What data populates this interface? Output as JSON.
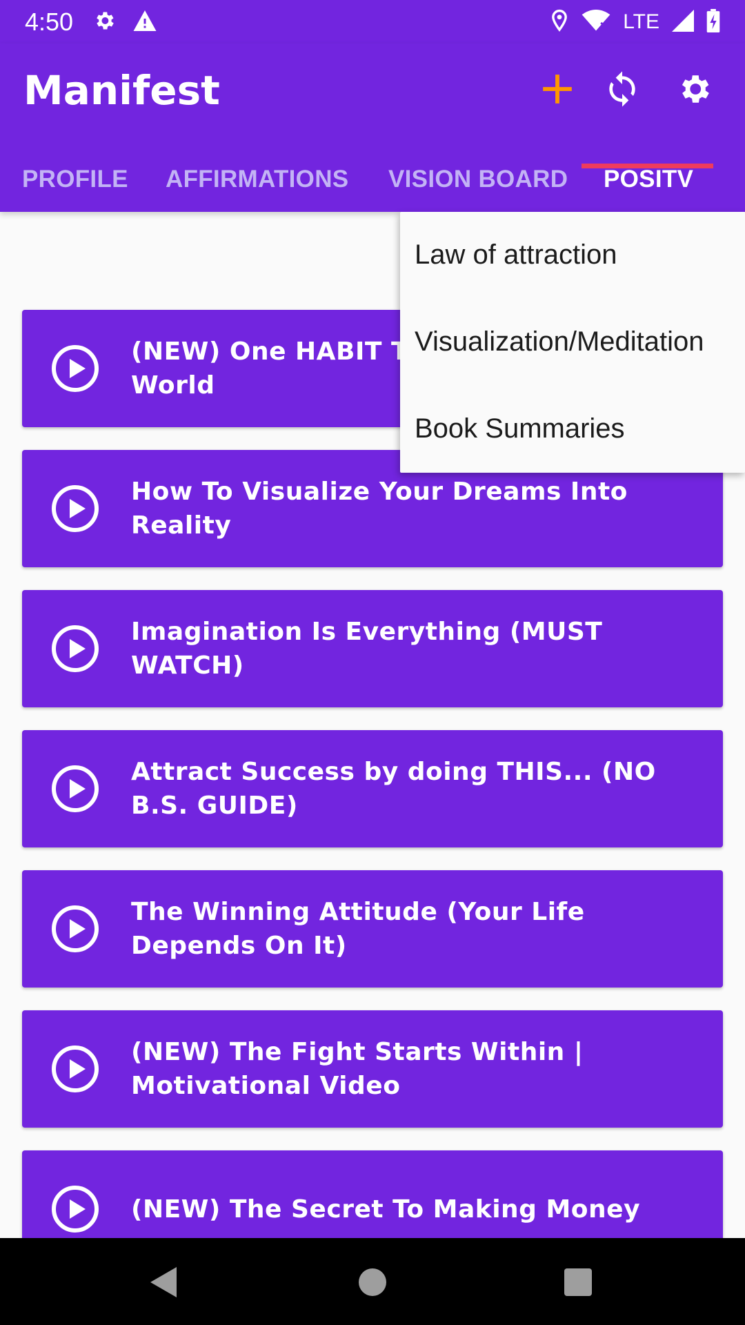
{
  "status_bar": {
    "time": "4:50",
    "network": "LTE",
    "icons": [
      "gear-icon",
      "warning-icon",
      "location-icon",
      "wifi-icon",
      "signal-icon",
      "battery-icon"
    ]
  },
  "app_bar": {
    "title": "Manifest",
    "actions": [
      "add-icon",
      "sync-icon",
      "settings-icon"
    ],
    "add_color": "#ff9800"
  },
  "tabs": [
    {
      "label": "PROFILE",
      "active": false
    },
    {
      "label": "AFFIRMATIONS",
      "active": false
    },
    {
      "label": "VISION BOARD",
      "active": false
    },
    {
      "label": "POSITV",
      "active": true
    }
  ],
  "dropdown": {
    "items": [
      "Law of attraction",
      "Visualization/Meditation",
      "Book Summaries"
    ]
  },
  "videos": [
    {
      "title": "(NEW) One HABIT Th\nWorld"
    },
    {
      "title": "How To Visualize Your Dreams Into Reality"
    },
    {
      "title": "Imagination Is Everything (MUST WATCH)"
    },
    {
      "title": "Attract Success by doing THIS... (NO B.S. GUIDE)"
    },
    {
      "title": "The Winning Attitude (Your Life Depends On It)"
    },
    {
      "title": "(NEW) The Fight Starts Within | Motivational Video"
    },
    {
      "title": "(NEW) The Secret To Making Money"
    }
  ],
  "colors": {
    "primary": "#7225df",
    "tab_indicator": "#ef3b5c",
    "tab_inactive": "#c3b3f5"
  }
}
